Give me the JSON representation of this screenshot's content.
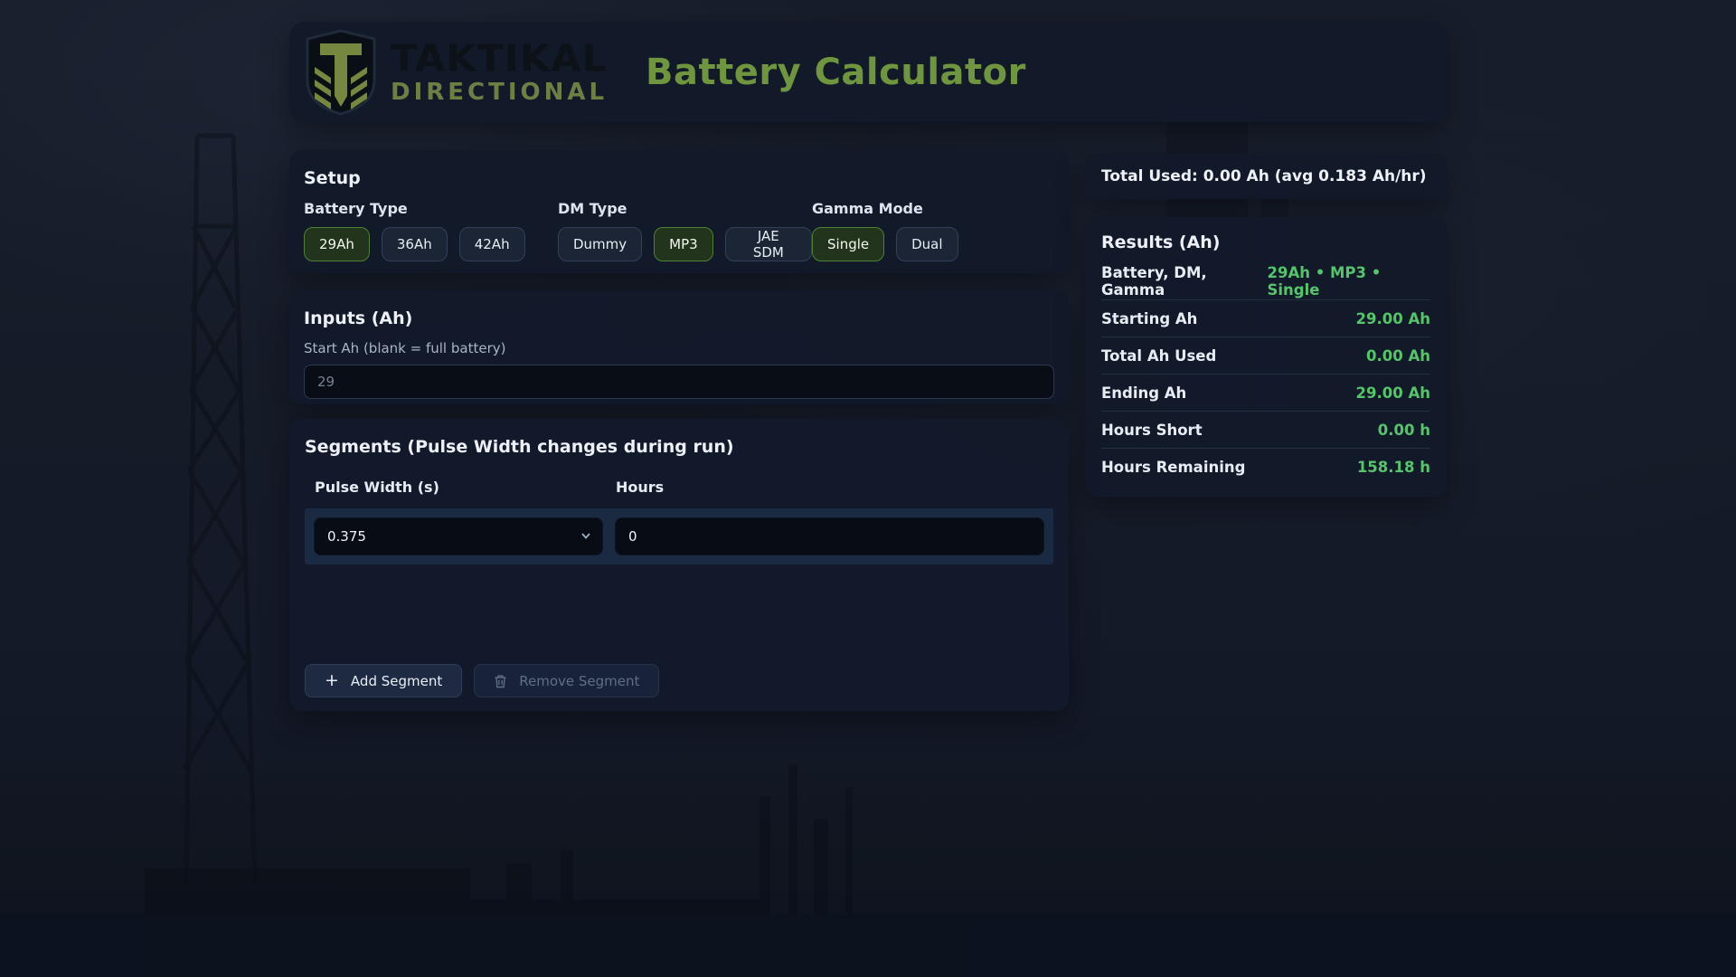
{
  "brand": {
    "name": "TAKTIKAL",
    "tagline": "DIRECTIONAL",
    "app_title": "Battery Calculator"
  },
  "colors": {
    "accent_green": "#55c46a",
    "title_green": "#6f963e",
    "selected_bg": "#22351c",
    "selected_border": "#4e8132",
    "card_bg": "#131a2a"
  },
  "setup": {
    "heading": "Setup",
    "groups": [
      {
        "label": "Battery Type",
        "options": [
          {
            "label": "29Ah",
            "selected": true
          },
          {
            "label": "36Ah",
            "selected": false
          },
          {
            "label": "42Ah",
            "selected": false
          }
        ]
      },
      {
        "label": "DM Type",
        "options": [
          {
            "label": "Dummy",
            "selected": false
          },
          {
            "label": "MP3",
            "selected": true
          },
          {
            "label": "JAE SDM",
            "selected": false
          }
        ]
      },
      {
        "label": "Gamma Mode",
        "options": [
          {
            "label": "Single",
            "selected": true
          },
          {
            "label": "Dual",
            "selected": false
          }
        ]
      }
    ]
  },
  "inputs": {
    "heading": "Inputs (Ah)",
    "start_label": "Start Ah (blank = full battery)",
    "start_placeholder": "29"
  },
  "segments": {
    "heading": "Segments (Pulse Width changes during run)",
    "col_pulse": "Pulse Width (s)",
    "col_hours": "Hours",
    "rows": [
      {
        "pulse_width": "0.375",
        "hours": "0"
      }
    ],
    "add_label": "Add Segment",
    "remove_label": "Remove Segment"
  },
  "summary": {
    "total_used": "Total Used: 0.00 Ah (avg 0.183 Ah/hr)"
  },
  "results": {
    "heading": "Results (Ah)",
    "rows": [
      {
        "label": "Battery, DM, Gamma",
        "value": "29Ah • MP3 • Single"
      },
      {
        "label": "Starting Ah",
        "value": "29.00 Ah"
      },
      {
        "label": "Total Ah Used",
        "value": "0.00 Ah"
      },
      {
        "label": "Ending Ah",
        "value": "29.00 Ah"
      },
      {
        "label": "Hours Short",
        "value": "0.00 h"
      },
      {
        "label": "Hours Remaining",
        "value": "158.18 h"
      }
    ]
  }
}
